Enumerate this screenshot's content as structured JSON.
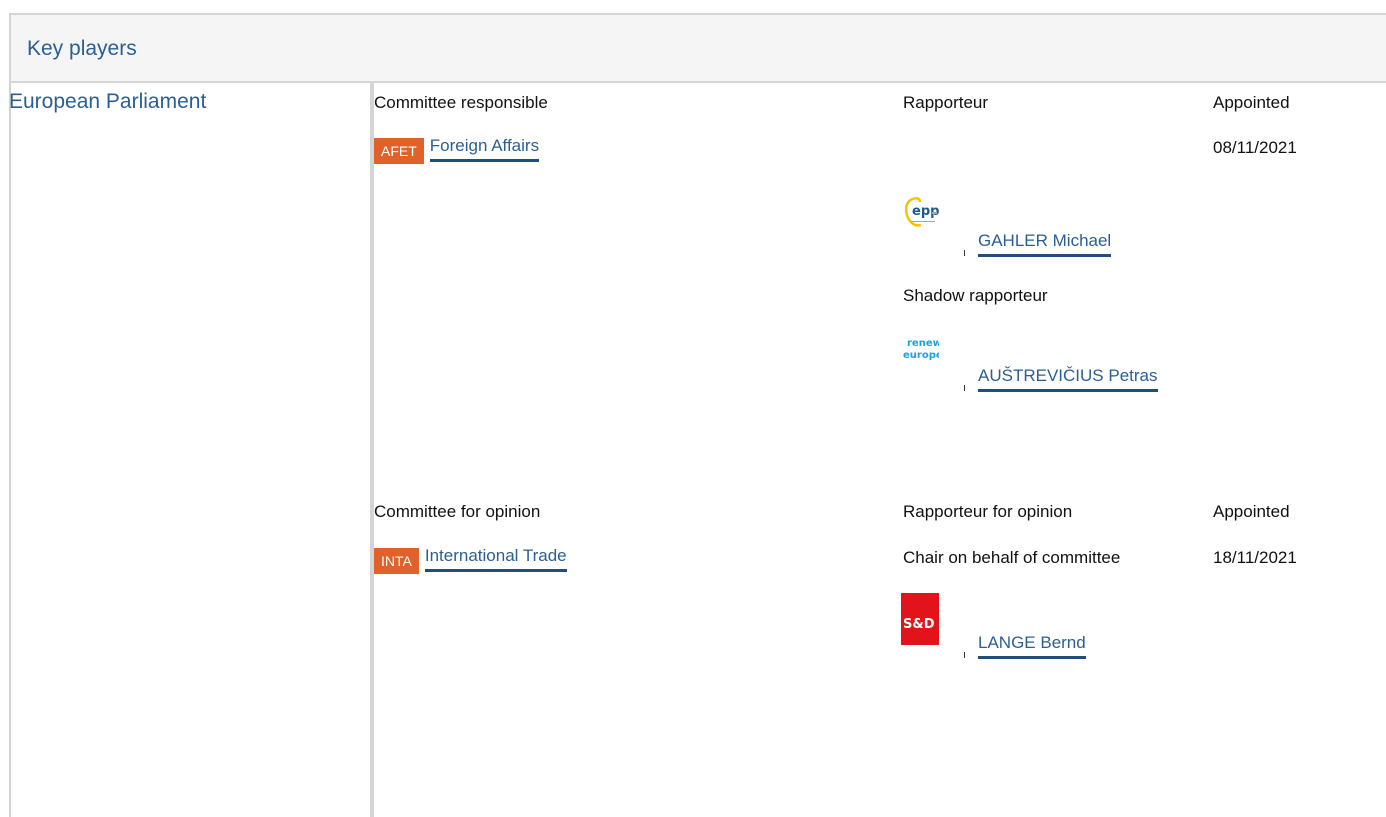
{
  "section": {
    "title": "Key players"
  },
  "institution": {
    "label": "European Parliament"
  },
  "headers": {
    "committee_responsible": "Committee responsible",
    "rapporteur": "Rapporteur",
    "appointed": "Appointed",
    "committee_for_opinion": "Committee for opinion",
    "rapporteur_for_opinion": "Rapporteur for opinion",
    "appointed_opinion": "Appointed"
  },
  "responsible": {
    "badge": "AFET",
    "committee": "Foreign Affairs",
    "appointed_date": "08/11/2021",
    "rapporteur": {
      "party_logo": "epp",
      "name": "GAHLER Michael"
    },
    "shadow_label": "Shadow rapporteur",
    "shadow": {
      "party_logo": "renew europe.",
      "name": "AUŠTREVIČIUS Petras"
    }
  },
  "opinion": {
    "badge": "INTA",
    "committee": "International Trade",
    "role": "Chair on behalf of committee",
    "appointed_date": "18/11/2021",
    "rapporteur": {
      "party_logo": "S&D",
      "name": "LANGE Bernd"
    }
  },
  "colors": {
    "link": "#2b5f93",
    "badge": "#e0622a",
    "header_bg": "#f5f5f5",
    "border": "#d4d4d4",
    "snd_red": "#e3131b",
    "renew_blue": "#1aa3dd",
    "epp_blue": "#1d5a8e",
    "epp_yellow": "#f6c200"
  }
}
